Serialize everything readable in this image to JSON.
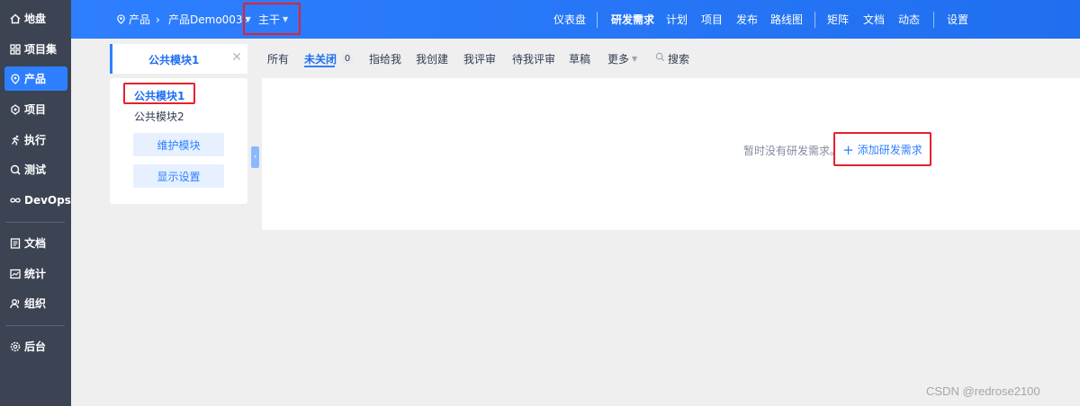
{
  "sidebar": {
    "items": [
      {
        "label": "地盘",
        "icon": "home-icon"
      },
      {
        "label": "项目集",
        "icon": "grid-icon"
      },
      {
        "label": "产品",
        "icon": "product-icon"
      },
      {
        "label": "项目",
        "icon": "project-icon"
      },
      {
        "label": "执行",
        "icon": "run-icon"
      },
      {
        "label": "测试",
        "icon": "test-icon"
      },
      {
        "label": "DevOps",
        "icon": "infinity-icon"
      },
      {
        "label": "文档",
        "icon": "doc-icon"
      },
      {
        "label": "统计",
        "icon": "chart-icon"
      },
      {
        "label": "组织",
        "icon": "people-icon"
      },
      {
        "label": "后台",
        "icon": "gear-icon"
      }
    ]
  },
  "topbar": {
    "breadcrumb": {
      "product": "产品",
      "product_name": "产品Demo003",
      "branch": "主干"
    },
    "nav": [
      "仪表盘",
      "研发需求",
      "计划",
      "项目",
      "发布",
      "路线图",
      "矩阵",
      "文档",
      "动态",
      "设置"
    ]
  },
  "modules": {
    "tab_label": "公共模块1",
    "items": [
      "公共模块1",
      "公共模块2"
    ],
    "maintain_button": "维护模块",
    "display_button": "显示设置"
  },
  "filters": {
    "all": "所有",
    "unclosed": "未关闭",
    "unclosed_count": "0",
    "assigned": "指给我",
    "created": "我创建",
    "reviewed": "我评审",
    "to_review": "待我评审",
    "draft": "草稿",
    "more": "更多",
    "search": "搜索"
  },
  "content": {
    "empty_text": "暂时没有研发需求。",
    "add_button": "添加研发需求"
  },
  "watermark": "CSDN @redrose2100",
  "colors": {
    "primary": "#2e7fff",
    "sidebar_bg": "#3c4353",
    "highlight_box": "#e5212b"
  }
}
